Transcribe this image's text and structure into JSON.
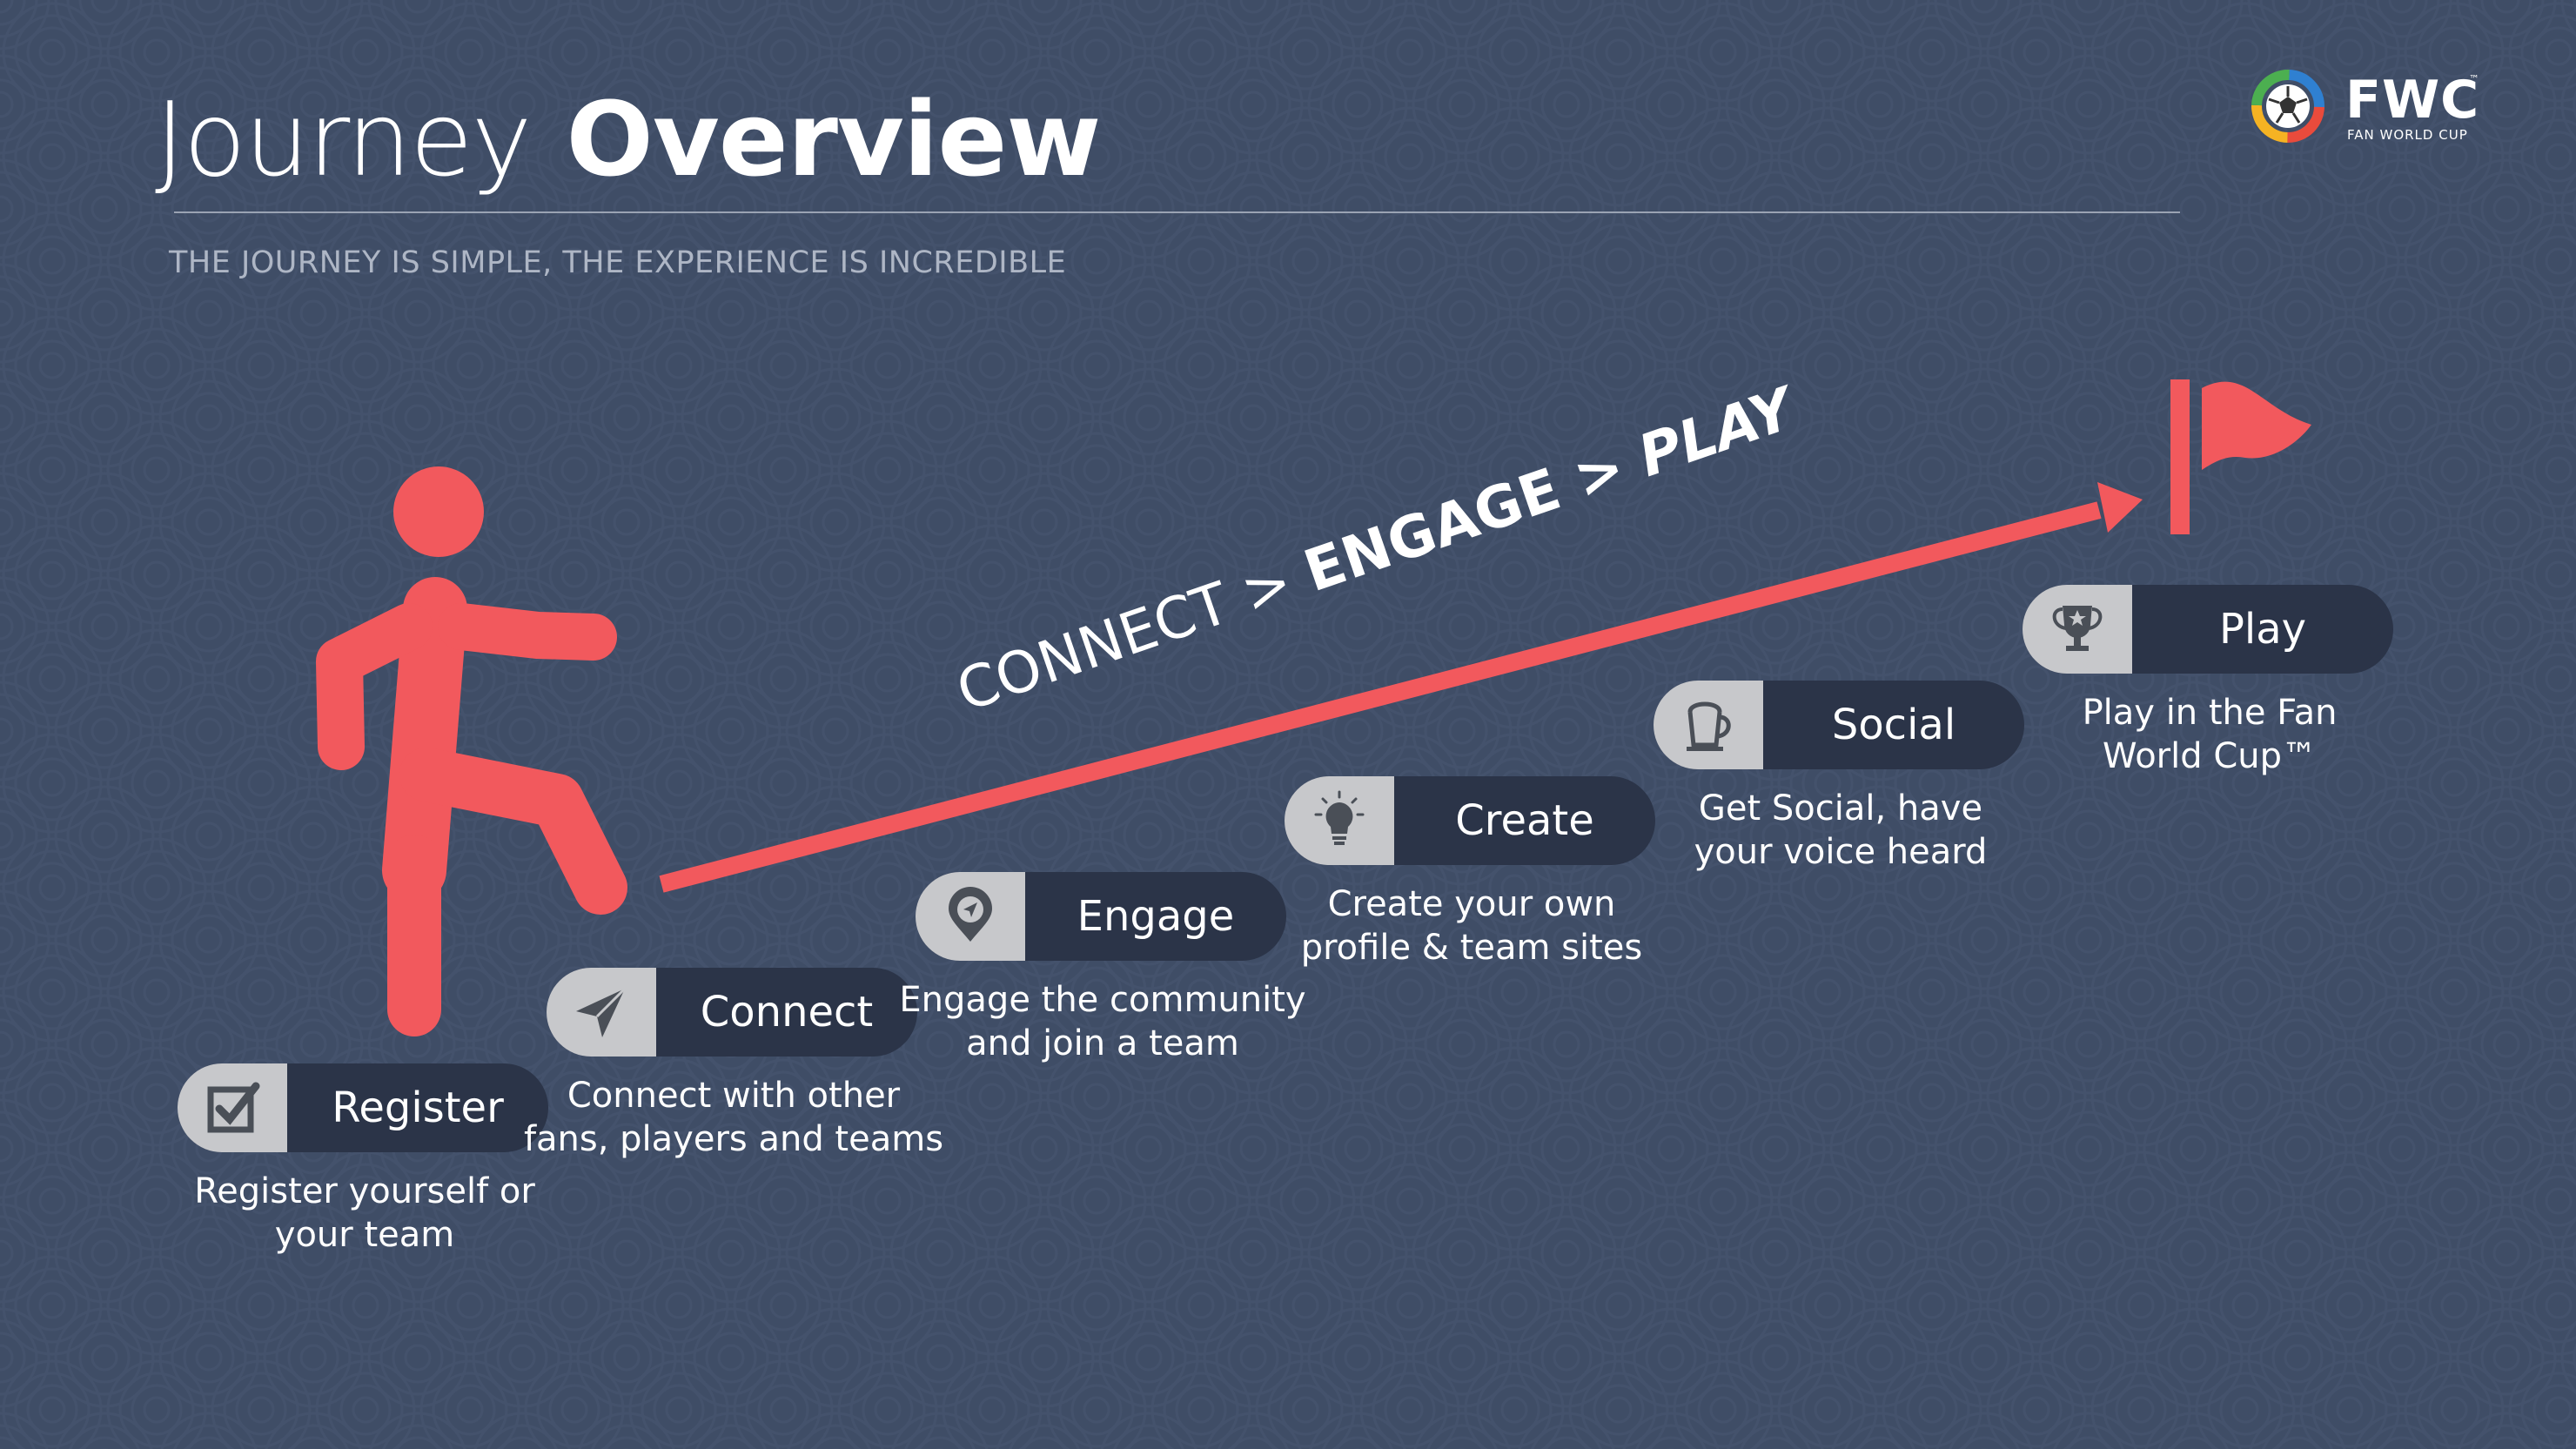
{
  "header": {
    "title_light": "Journey",
    "title_bold": "Overview",
    "subtitle": "THE JOURNEY IS SIMPLE, THE EXPERIENCE IS INCREDIBLE"
  },
  "logo": {
    "mark": "FWC",
    "trademark": "™",
    "tagline": "FAN WORLD CUP"
  },
  "slogan": {
    "part1": "CONNECT > ",
    "part2": "ENGAGE > ",
    "part3": "PLAY"
  },
  "steps": [
    {
      "label": "Register",
      "icon": "checkbox-icon",
      "desc_line1": "Register yourself or",
      "desc_line2": "your team"
    },
    {
      "label": "Connect",
      "icon": "paper-plane-icon",
      "desc_line1": "Connect with other",
      "desc_line2": "fans, players and teams"
    },
    {
      "label": "Engage",
      "icon": "location-pin-icon",
      "desc_line1": "Engage the community",
      "desc_line2": "and join a team"
    },
    {
      "label": "Create",
      "icon": "lightbulb-icon",
      "desc_line1": "Create your own",
      "desc_line2": "profile & team sites"
    },
    {
      "label": "Social",
      "icon": "beer-mug-icon",
      "desc_line1": "Get Social, have",
      "desc_line2": "your voice heard"
    },
    {
      "label": "Play",
      "icon": "trophy-icon",
      "desc_line1": "Play in the Fan",
      "desc_line2": "World Cup™"
    }
  ],
  "colors": {
    "background": "#3f4d66",
    "accent": "#f2595d",
    "pill_dark": "#2b3448",
    "pill_icon_bg": "#c7c8cb",
    "icon_dark": "#4a4f57"
  }
}
